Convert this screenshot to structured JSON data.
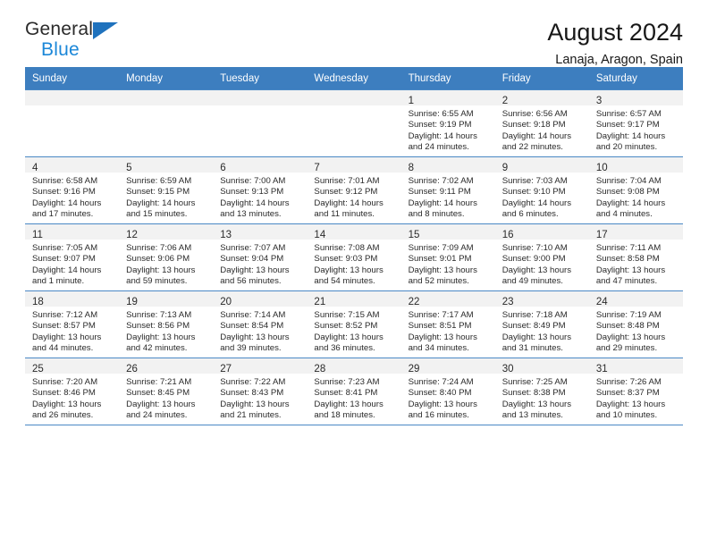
{
  "brand": {
    "name_top": "General",
    "name_bottom": "Blue",
    "triangle_color": "#1f72bd",
    "blue_text_color": "#1b87d8"
  },
  "header": {
    "title": "August 2024",
    "subtitle": "Lanaja, Aragon, Spain"
  },
  "theme": {
    "header_blue": "#3d7ebf",
    "grid_line": "#4a88c5",
    "daynum_band": "#f2f2f2",
    "text": "#2a2a2a"
  },
  "weekday_headers": [
    "Sunday",
    "Monday",
    "Tuesday",
    "Wednesday",
    "Thursday",
    "Friday",
    "Saturday"
  ],
  "labels": {
    "sunrise_prefix": "Sunrise:",
    "sunset_prefix": "Sunset:",
    "daylight_prefix": "Daylight:"
  },
  "weeks": [
    [
      {
        "day": "",
        "sunrise": "",
        "sunset": "",
        "daylight_line1": "",
        "daylight_line2": ""
      },
      {
        "day": "",
        "sunrise": "",
        "sunset": "",
        "daylight_line1": "",
        "daylight_line2": ""
      },
      {
        "day": "",
        "sunrise": "",
        "sunset": "",
        "daylight_line1": "",
        "daylight_line2": ""
      },
      {
        "day": "",
        "sunrise": "",
        "sunset": "",
        "daylight_line1": "",
        "daylight_line2": ""
      },
      {
        "day": "1",
        "sunrise": "Sunrise: 6:55 AM",
        "sunset": "Sunset: 9:19 PM",
        "daylight_line1": "Daylight: 14 hours",
        "daylight_line2": "and 24 minutes."
      },
      {
        "day": "2",
        "sunrise": "Sunrise: 6:56 AM",
        "sunset": "Sunset: 9:18 PM",
        "daylight_line1": "Daylight: 14 hours",
        "daylight_line2": "and 22 minutes."
      },
      {
        "day": "3",
        "sunrise": "Sunrise: 6:57 AM",
        "sunset": "Sunset: 9:17 PM",
        "daylight_line1": "Daylight: 14 hours",
        "daylight_line2": "and 20 minutes."
      }
    ],
    [
      {
        "day": "4",
        "sunrise": "Sunrise: 6:58 AM",
        "sunset": "Sunset: 9:16 PM",
        "daylight_line1": "Daylight: 14 hours",
        "daylight_line2": "and 17 minutes."
      },
      {
        "day": "5",
        "sunrise": "Sunrise: 6:59 AM",
        "sunset": "Sunset: 9:15 PM",
        "daylight_line1": "Daylight: 14 hours",
        "daylight_line2": "and 15 minutes."
      },
      {
        "day": "6",
        "sunrise": "Sunrise: 7:00 AM",
        "sunset": "Sunset: 9:13 PM",
        "daylight_line1": "Daylight: 14 hours",
        "daylight_line2": "and 13 minutes."
      },
      {
        "day": "7",
        "sunrise": "Sunrise: 7:01 AM",
        "sunset": "Sunset: 9:12 PM",
        "daylight_line1": "Daylight: 14 hours",
        "daylight_line2": "and 11 minutes."
      },
      {
        "day": "8",
        "sunrise": "Sunrise: 7:02 AM",
        "sunset": "Sunset: 9:11 PM",
        "daylight_line1": "Daylight: 14 hours",
        "daylight_line2": "and 8 minutes."
      },
      {
        "day": "9",
        "sunrise": "Sunrise: 7:03 AM",
        "sunset": "Sunset: 9:10 PM",
        "daylight_line1": "Daylight: 14 hours",
        "daylight_line2": "and 6 minutes."
      },
      {
        "day": "10",
        "sunrise": "Sunrise: 7:04 AM",
        "sunset": "Sunset: 9:08 PM",
        "daylight_line1": "Daylight: 14 hours",
        "daylight_line2": "and 4 minutes."
      }
    ],
    [
      {
        "day": "11",
        "sunrise": "Sunrise: 7:05 AM",
        "sunset": "Sunset: 9:07 PM",
        "daylight_line1": "Daylight: 14 hours",
        "daylight_line2": "and 1 minute."
      },
      {
        "day": "12",
        "sunrise": "Sunrise: 7:06 AM",
        "sunset": "Sunset: 9:06 PM",
        "daylight_line1": "Daylight: 13 hours",
        "daylight_line2": "and 59 minutes."
      },
      {
        "day": "13",
        "sunrise": "Sunrise: 7:07 AM",
        "sunset": "Sunset: 9:04 PM",
        "daylight_line1": "Daylight: 13 hours",
        "daylight_line2": "and 56 minutes."
      },
      {
        "day": "14",
        "sunrise": "Sunrise: 7:08 AM",
        "sunset": "Sunset: 9:03 PM",
        "daylight_line1": "Daylight: 13 hours",
        "daylight_line2": "and 54 minutes."
      },
      {
        "day": "15",
        "sunrise": "Sunrise: 7:09 AM",
        "sunset": "Sunset: 9:01 PM",
        "daylight_line1": "Daylight: 13 hours",
        "daylight_line2": "and 52 minutes."
      },
      {
        "day": "16",
        "sunrise": "Sunrise: 7:10 AM",
        "sunset": "Sunset: 9:00 PM",
        "daylight_line1": "Daylight: 13 hours",
        "daylight_line2": "and 49 minutes."
      },
      {
        "day": "17",
        "sunrise": "Sunrise: 7:11 AM",
        "sunset": "Sunset: 8:58 PM",
        "daylight_line1": "Daylight: 13 hours",
        "daylight_line2": "and 47 minutes."
      }
    ],
    [
      {
        "day": "18",
        "sunrise": "Sunrise: 7:12 AM",
        "sunset": "Sunset: 8:57 PM",
        "daylight_line1": "Daylight: 13 hours",
        "daylight_line2": "and 44 minutes."
      },
      {
        "day": "19",
        "sunrise": "Sunrise: 7:13 AM",
        "sunset": "Sunset: 8:56 PM",
        "daylight_line1": "Daylight: 13 hours",
        "daylight_line2": "and 42 minutes."
      },
      {
        "day": "20",
        "sunrise": "Sunrise: 7:14 AM",
        "sunset": "Sunset: 8:54 PM",
        "daylight_line1": "Daylight: 13 hours",
        "daylight_line2": "and 39 minutes."
      },
      {
        "day": "21",
        "sunrise": "Sunrise: 7:15 AM",
        "sunset": "Sunset: 8:52 PM",
        "daylight_line1": "Daylight: 13 hours",
        "daylight_line2": "and 36 minutes."
      },
      {
        "day": "22",
        "sunrise": "Sunrise: 7:17 AM",
        "sunset": "Sunset: 8:51 PM",
        "daylight_line1": "Daylight: 13 hours",
        "daylight_line2": "and 34 minutes."
      },
      {
        "day": "23",
        "sunrise": "Sunrise: 7:18 AM",
        "sunset": "Sunset: 8:49 PM",
        "daylight_line1": "Daylight: 13 hours",
        "daylight_line2": "and 31 minutes."
      },
      {
        "day": "24",
        "sunrise": "Sunrise: 7:19 AM",
        "sunset": "Sunset: 8:48 PM",
        "daylight_line1": "Daylight: 13 hours",
        "daylight_line2": "and 29 minutes."
      }
    ],
    [
      {
        "day": "25",
        "sunrise": "Sunrise: 7:20 AM",
        "sunset": "Sunset: 8:46 PM",
        "daylight_line1": "Daylight: 13 hours",
        "daylight_line2": "and 26 minutes."
      },
      {
        "day": "26",
        "sunrise": "Sunrise: 7:21 AM",
        "sunset": "Sunset: 8:45 PM",
        "daylight_line1": "Daylight: 13 hours",
        "daylight_line2": "and 24 minutes."
      },
      {
        "day": "27",
        "sunrise": "Sunrise: 7:22 AM",
        "sunset": "Sunset: 8:43 PM",
        "daylight_line1": "Daylight: 13 hours",
        "daylight_line2": "and 21 minutes."
      },
      {
        "day": "28",
        "sunrise": "Sunrise: 7:23 AM",
        "sunset": "Sunset: 8:41 PM",
        "daylight_line1": "Daylight: 13 hours",
        "daylight_line2": "and 18 minutes."
      },
      {
        "day": "29",
        "sunrise": "Sunrise: 7:24 AM",
        "sunset": "Sunset: 8:40 PM",
        "daylight_line1": "Daylight: 13 hours",
        "daylight_line2": "and 16 minutes."
      },
      {
        "day": "30",
        "sunrise": "Sunrise: 7:25 AM",
        "sunset": "Sunset: 8:38 PM",
        "daylight_line1": "Daylight: 13 hours",
        "daylight_line2": "and 13 minutes."
      },
      {
        "day": "31",
        "sunrise": "Sunrise: 7:26 AM",
        "sunset": "Sunset: 8:37 PM",
        "daylight_line1": "Daylight: 13 hours",
        "daylight_line2": "and 10 minutes."
      }
    ]
  ]
}
